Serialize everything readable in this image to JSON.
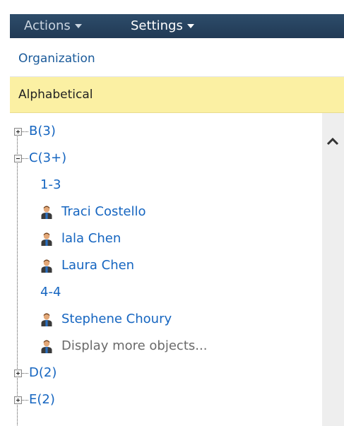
{
  "menubar": {
    "actions_label": "Actions",
    "settings_label": "Settings"
  },
  "tabs": {
    "organization": "Organization",
    "alphabetical": "Alphabetical"
  },
  "tree": {
    "b": "B(3)",
    "c": "C(3+)",
    "range_1": "1-3",
    "user_1": "Traci Costello",
    "user_2": "lala Chen",
    "user_3": "Laura Chen",
    "range_2": "4-4",
    "user_4": "Stephene Choury",
    "more": "Display more objects...",
    "d": "D(2)",
    "e": "E(2)"
  },
  "colors": {
    "header_bg": "#213a55",
    "selected_tab_bg": "#fbf0a3",
    "link": "#1565c0"
  },
  "icons": {
    "user": "user-icon",
    "expand": "plus-box-icon",
    "collapse": "minus-box-icon",
    "scroll_up": "chevron-up-icon"
  }
}
